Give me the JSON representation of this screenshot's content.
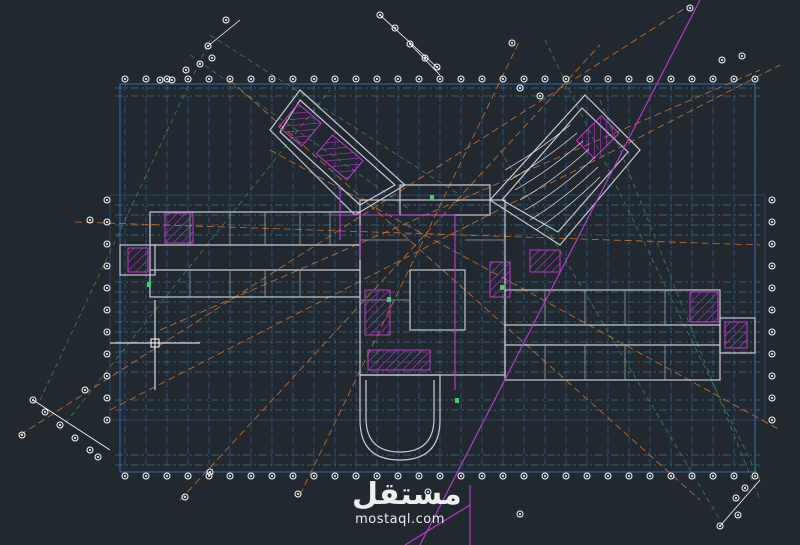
{
  "drawing": {
    "kind": "architectural floor plan",
    "colors": {
      "background": "#212830",
      "walls": "#c8ccd4",
      "grid_blue": "#3a7fd0",
      "grid_cyan": "#4fb7d6",
      "dim_orange": "#e0782a",
      "dim_green": "#4a9a63",
      "furniture_magenta": "#d23ad9",
      "section_purple": "#c03ad6",
      "markers": "#ffffff",
      "cursor": "#ffffff"
    }
  },
  "watermark": {
    "arabic": "مستقل",
    "latin": "mostaql.com"
  }
}
